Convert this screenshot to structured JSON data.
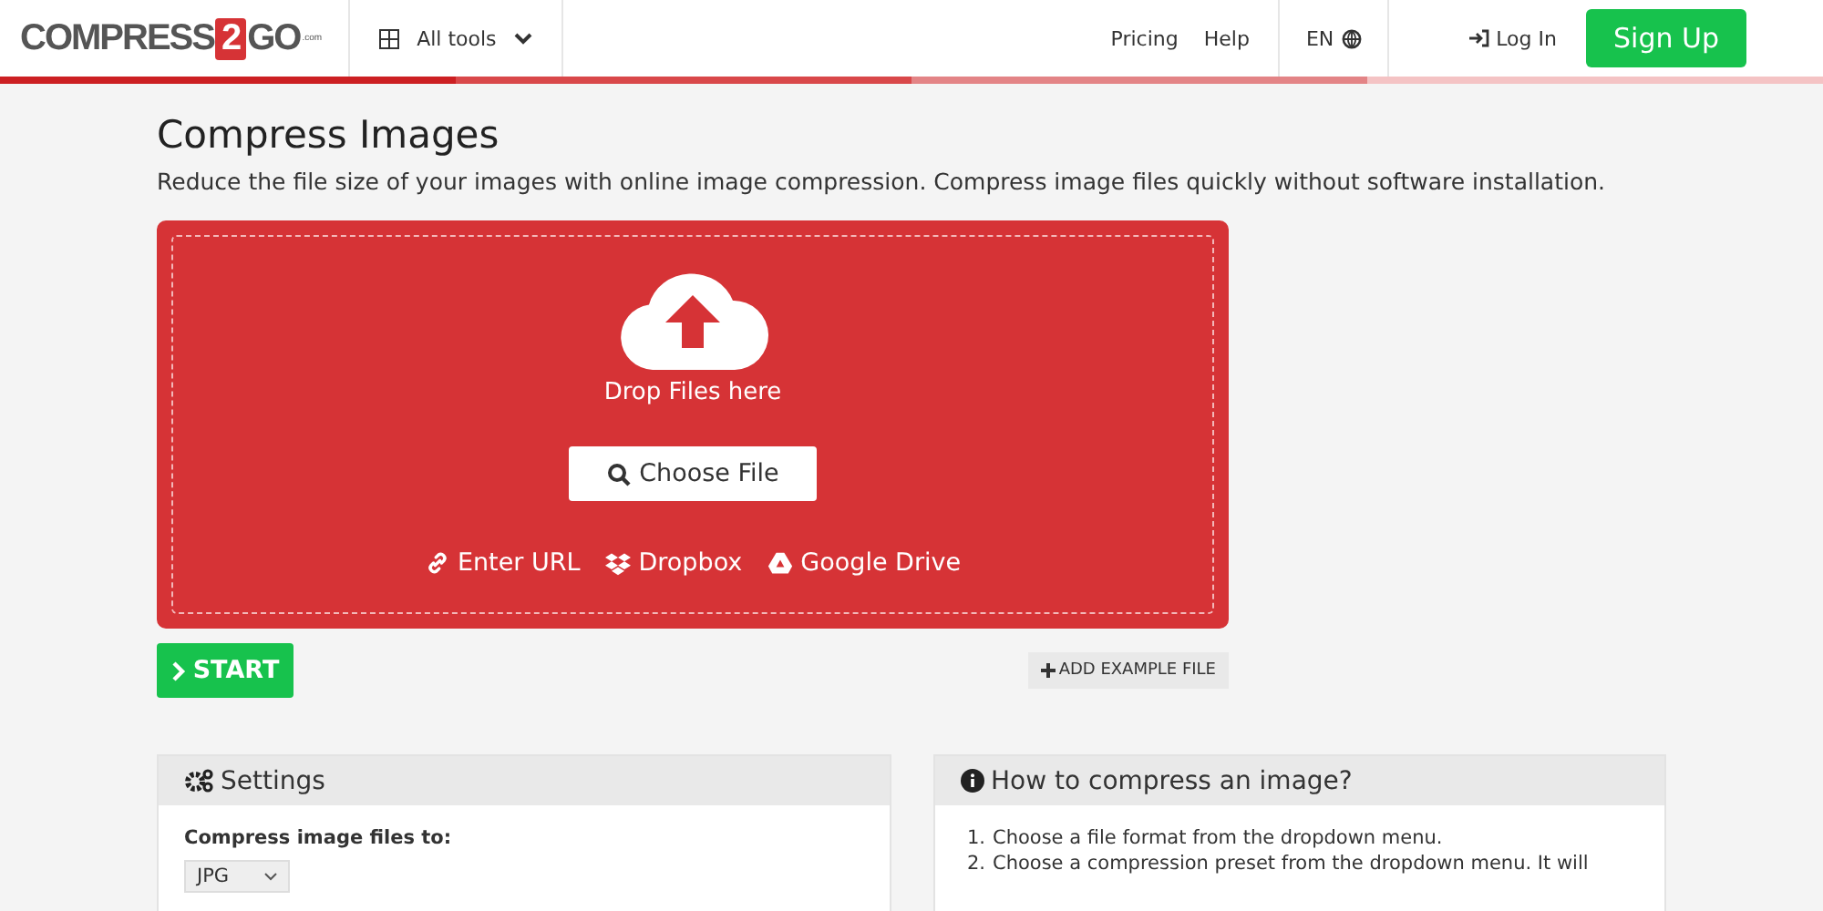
{
  "header": {
    "logo": {
      "text": "COMPRESS",
      "digit": "2",
      "suffix": "GO",
      "tld": ".com"
    },
    "tools_menu": "All tools",
    "links": [
      "Pricing",
      "Help"
    ],
    "language": "EN",
    "login": "Log In",
    "signup": "Sign Up"
  },
  "page": {
    "title": "Compress Images",
    "description": "Reduce the file size of your images with online image compression. Compress image files quickly without software installation."
  },
  "dropzone": {
    "label": "Drop Files here",
    "choose_button": "Choose File",
    "sources": [
      {
        "kind": "url",
        "label": "Enter URL"
      },
      {
        "kind": "dropbox",
        "label": "Dropbox"
      },
      {
        "kind": "drive",
        "label": "Google Drive"
      }
    ]
  },
  "start_button": "START",
  "example_button": "ADD EXAMPLE FILE",
  "settings": {
    "title": "Settings",
    "field_label": "Compress image files to:",
    "format_value": "JPG"
  },
  "howto": {
    "title": "How to compress an image?",
    "steps": [
      {
        "number": "1.",
        "text": "Choose a file format from the dropdown menu."
      },
      {
        "number": "2.",
        "text": "Choose a compression preset from the dropdown menu. It will"
      }
    ]
  }
}
